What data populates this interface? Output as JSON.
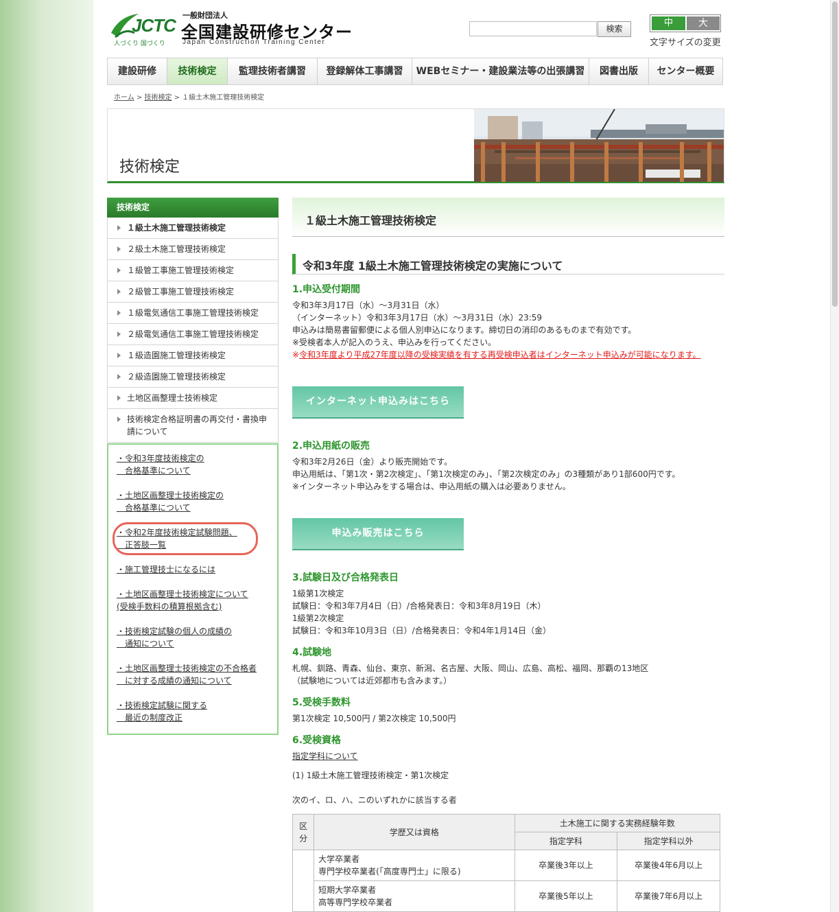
{
  "header": {
    "logo_jctc": "JCTC",
    "logo_tagline": "人づくり 国づくり",
    "logo_small": "一般財団法人",
    "logo_main": "全国建設研修センター",
    "logo_en": "Japan Construction Training Center",
    "search_button": "検索",
    "size_mid": "中",
    "size_big": "大",
    "size_label": "文字サイズの変更"
  },
  "nav": [
    "建設研修",
    "技術検定",
    "監理技術者講習",
    "登録解体工事講習",
    "WEBセミナー・建設業法等の出張講習",
    "図書出版",
    "センター概要"
  ],
  "breadcrumb": {
    "home": "ホーム",
    "sep": ">",
    "parent": "技術検定",
    "current": "１級土木施工管理技術検定"
  },
  "hero_title": "技術検定",
  "sidebar": {
    "heading": "技術検定",
    "items": [
      "１級土木施工管理技術検定",
      "２級土木施工管理技術検定",
      "１級管工事施工管理技術検定",
      "２級管工事施工管理技術検定",
      "１級電気通信工事施工管理技術検定",
      "２級電気通信工事施工管理技術検定",
      "１級造園施工管理技術検定",
      "２級造園施工管理技術検定",
      "土地区画整理士技術検定",
      "技術検定合格証明書の再交付・書換申請について"
    ],
    "links": [
      [
        "・令和3年度技術検定の",
        "　合格基準について"
      ],
      [
        "・土地区画整理士技術検定の",
        "　合格基準について"
      ],
      [
        "・令和2年度技術検定試験問題、",
        "　正答肢一覧"
      ],
      [
        "・施工管理技士になるには"
      ],
      [
        "・土地区画整理士技術検定について",
        "(受検手数料の積算根拠含む)"
      ],
      [
        "・技術検定試験の個人の成績の",
        "　通知について"
      ],
      [
        "・土地区画整理士技術検定の不合格者",
        "　に対する成績の通知について"
      ],
      [
        "・技術検定試験に関する",
        "　最近の制度改正"
      ]
    ]
  },
  "main": {
    "h1": "１級土木施工管理技術検定",
    "h2": "令和3年度 1級土木施工管理技術検定の実施について",
    "s1": {
      "title": "1.申込受付期間",
      "lines": [
        "令和3年3月17日（水）～3月31日（水）",
        "（インターネット）令和3年3月17日（水）～3月31日（水）23:59",
        "申込みは簡易書留郵便による個人別申込になります。締切日の消印のあるものまで有効です。",
        "※受検者本人が記入のうえ、申込みを行ってください。"
      ],
      "note_mark": "※",
      "note": "令和3年度より平成27年度以降の受検実績を有する再受検申込者はインターネット申込みが可能になります。"
    },
    "btn_internet": "インターネット申込みはこちら",
    "s2": {
      "title": "2.申込用紙の販売",
      "lines": [
        "令和3年2月26日（金）より販売開始です。",
        "申込用紙は、「第1次・第2次検定」、「第1次検定のみ」、「第2次検定のみ」の3種類があり1部600円です。",
        "※インターネット申込みをする場合は、申込用紙の購入は必要ありません。"
      ]
    },
    "btn_sales": "申込み販売はこちら",
    "s3": {
      "title": "3.試験日及び合格発表日",
      "lines": [
        "1級第1次検定",
        "試験日：令和3年7月4日（日）/合格発表日：令和3年8月19日（木）",
        "1級第2次検定",
        "試験日：令和3年10月3日（日）/合格発表日：令和4年1月14日（金）"
      ]
    },
    "s4": {
      "title": "4.試験地",
      "lines": [
        "札幌、釧路、青森、仙台、東京、新潟、名古屋、大阪、岡山、広島、高松、福岡、那覇の13地区",
        "（試験地については近郊都市も含みます。）"
      ]
    },
    "s5": {
      "title": "5.受検手数料",
      "line": "第1次検定 10,500円 / 第2次検定 10,500円"
    },
    "s6": {
      "title": "6.受検資格",
      "link": "指定学科について",
      "sub": "(1) 1級土木施工管理技術検定・第1次検定",
      "intro": "次のイ、ロ、ハ、ニのいずれかに該当する者"
    },
    "table": {
      "h_kubun": "区分",
      "h_gakureki": "学歴又は資格",
      "h_years": "土木施工に関する実務経験年数",
      "h_shitei": "指定学科",
      "h_igai": "指定学科以外",
      "rows": [
        {
          "l1": "大学卒業者",
          "l2": "専門学校卒業者(「高度専門士」に限る)",
          "a": "卒業後3年以上",
          "b": "卒業後4年6月以上"
        },
        {
          "l1": "短期大学卒業者",
          "l2": "高等専門学校卒業者",
          "a": "卒業後5年以上",
          "b": "卒業後7年6月以上"
        }
      ]
    }
  }
}
